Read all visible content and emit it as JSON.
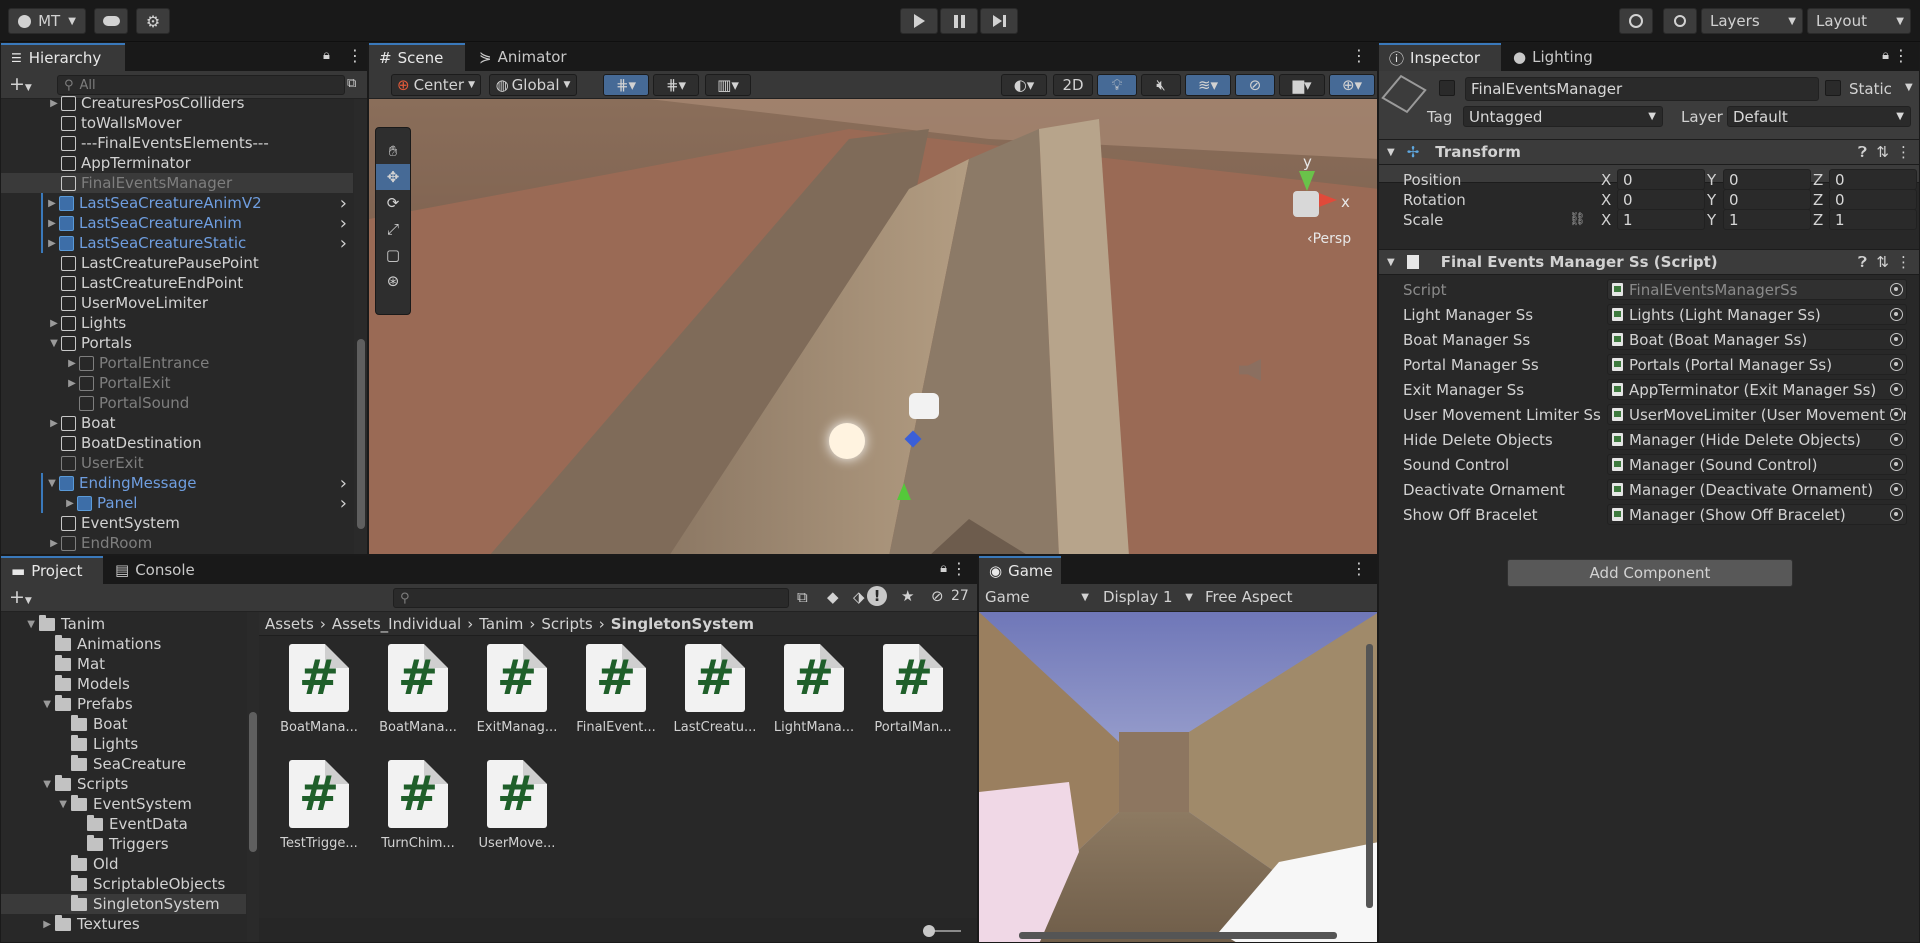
{
  "topbar": {
    "account_label": "MT",
    "layers_label": "Layers",
    "layout_label": "Layout"
  },
  "hierarchy": {
    "tab_label": "Hierarchy",
    "search_placeholder": "All",
    "items": [
      {
        "label": "CreaturesPosColliders",
        "indent": 1,
        "fold": "closed",
        "style": "normal"
      },
      {
        "label": "toWallsMover",
        "indent": 1,
        "fold": "none",
        "style": "normal"
      },
      {
        "label": "---FinalEventsElements---",
        "indent": 1,
        "fold": "none",
        "style": "normal"
      },
      {
        "label": "AppTerminator",
        "indent": 1,
        "fold": "none",
        "style": "normal"
      },
      {
        "label": "FinalEventsManager",
        "indent": 1,
        "fold": "none",
        "style": "selected"
      },
      {
        "label": "LastSeaCreatureAnimV2",
        "indent": 1,
        "fold": "closed",
        "style": "prefab"
      },
      {
        "label": "LastSeaCreatureAnim",
        "indent": 1,
        "fold": "closed",
        "style": "prefab"
      },
      {
        "label": "LastSeaCreatureStatic",
        "indent": 1,
        "fold": "closed",
        "style": "prefab"
      },
      {
        "label": "LastCreaturePausePoint",
        "indent": 1,
        "fold": "none",
        "style": "normal"
      },
      {
        "label": "LastCreatureEndPoint",
        "indent": 1,
        "fold": "none",
        "style": "normal"
      },
      {
        "label": "UserMoveLimiter",
        "indent": 1,
        "fold": "none",
        "style": "normal"
      },
      {
        "label": "Lights",
        "indent": 1,
        "fold": "closed",
        "style": "normal"
      },
      {
        "label": "Portals",
        "indent": 1,
        "fold": "open",
        "style": "normal"
      },
      {
        "label": "PortalEntrance",
        "indent": 2,
        "fold": "closed",
        "style": "inactive"
      },
      {
        "label": "PortalExit",
        "indent": 2,
        "fold": "closed",
        "style": "inactive"
      },
      {
        "label": "PortalSound",
        "indent": 2,
        "fold": "none",
        "style": "inactive"
      },
      {
        "label": "Boat",
        "indent": 1,
        "fold": "closed",
        "style": "normal"
      },
      {
        "label": "BoatDestination",
        "indent": 1,
        "fold": "none",
        "style": "normal"
      },
      {
        "label": "UserExit",
        "indent": 1,
        "fold": "none",
        "style": "inactive"
      },
      {
        "label": "EndingMessage",
        "indent": 1,
        "fold": "open",
        "style": "prefab"
      },
      {
        "label": "Panel",
        "indent": 2,
        "fold": "closed",
        "style": "prefab"
      },
      {
        "label": "EventSystem",
        "indent": 1,
        "fold": "none",
        "style": "normal"
      },
      {
        "label": "EndRoom",
        "indent": 1,
        "fold": "closed",
        "style": "inactive"
      }
    ]
  },
  "scene": {
    "tabs": [
      "Scene",
      "Animator"
    ],
    "pivot_label": "Center",
    "space_label": "Global",
    "mode_2d_label": "2D",
    "persp_label": "‹Persp",
    "gizmo_y": "y",
    "gizmo_x": "x"
  },
  "inspector": {
    "tabs": [
      "Inspector",
      "Lighting"
    ],
    "object_name": "FinalEventsManager",
    "static_label": "Static",
    "tag_label": "Tag",
    "tag_value": "Untagged",
    "layer_label": "Layer",
    "layer_value": "Default",
    "transform": {
      "title": "Transform",
      "rows": [
        {
          "label": "Position",
          "x": "0",
          "y": "0",
          "z": "0"
        },
        {
          "label": "Rotation",
          "x": "0",
          "y": "0",
          "z": "0"
        },
        {
          "label": "Scale",
          "x": "1",
          "y": "1",
          "z": "1"
        }
      ],
      "axis_x": "X",
      "axis_y": "Y",
      "axis_z": "Z"
    },
    "script_component": {
      "title": "Final Events Manager Ss (Script)",
      "script_label": "Script",
      "script_value": "FinalEventsManagerSs",
      "fields": [
        {
          "label": "Light Manager Ss",
          "value": "Lights (Light Manager Ss)"
        },
        {
          "label": "Boat Manager Ss",
          "value": "Boat (Boat Manager Ss)"
        },
        {
          "label": "Portal Manager Ss",
          "value": "Portals (Portal Manager Ss)"
        },
        {
          "label": "Exit Manager Ss",
          "value": "AppTerminator (Exit Manager Ss)"
        },
        {
          "label": "User Movement Limiter Ss",
          "value": "UserMoveLimiter (User Movement Lim"
        },
        {
          "label": "Hide Delete Objects",
          "value": "Manager (Hide Delete Objects)"
        },
        {
          "label": "Sound Control",
          "value": "Manager (Sound Control)"
        },
        {
          "label": "Deactivate Ornament",
          "value": "Manager (Deactivate Ornament)"
        },
        {
          "label": "Show Off Bracelet",
          "value": "Manager (Show Off Bracelet)"
        }
      ]
    },
    "add_component_label": "Add Component"
  },
  "project": {
    "tabs": [
      "Project",
      "Console"
    ],
    "hidden_count": "27",
    "tree": [
      {
        "label": "Tanim",
        "indent": 0,
        "fold": "open"
      },
      {
        "label": "Animations",
        "indent": 1,
        "fold": "none"
      },
      {
        "label": "Mat",
        "indent": 1,
        "fold": "none"
      },
      {
        "label": "Models",
        "indent": 1,
        "fold": "none"
      },
      {
        "label": "Prefabs",
        "indent": 1,
        "fold": "open"
      },
      {
        "label": "Boat",
        "indent": 2,
        "fold": "none"
      },
      {
        "label": "Lights",
        "indent": 2,
        "fold": "none"
      },
      {
        "label": "SeaCreature",
        "indent": 2,
        "fold": "none"
      },
      {
        "label": "Scripts",
        "indent": 1,
        "fold": "open"
      },
      {
        "label": "EventSystem",
        "indent": 2,
        "fold": "open"
      },
      {
        "label": "EventData",
        "indent": 3,
        "fold": "none"
      },
      {
        "label": "Triggers",
        "indent": 3,
        "fold": "none"
      },
      {
        "label": "Old",
        "indent": 2,
        "fold": "none"
      },
      {
        "label": "ScriptableObjects",
        "indent": 2,
        "fold": "none"
      },
      {
        "label": "SingletonSystem",
        "indent": 2,
        "fold": "none",
        "selected": true
      },
      {
        "label": "Textures",
        "indent": 1,
        "fold": "closed"
      }
    ],
    "breadcrumb": [
      "Assets",
      "Assets_Individual",
      "Tanim",
      "Scripts",
      "SingletonSystem"
    ],
    "assets": [
      "BoatMana...",
      "BoatMana...",
      "ExitManag...",
      "FinalEvent...",
      "LastCreatu...",
      "LightMana...",
      "PortalMan...",
      "TestTrigge...",
      "TurnChim...",
      "UserMove..."
    ],
    "asset_glyph": "#"
  },
  "game": {
    "tab_label": "Game",
    "mode_label": "Game",
    "display_label": "Display 1",
    "aspect_label": "Free Aspect"
  },
  "colors": {
    "accent": "#3a79bb",
    "prefab_text": "#6f9ee0"
  }
}
